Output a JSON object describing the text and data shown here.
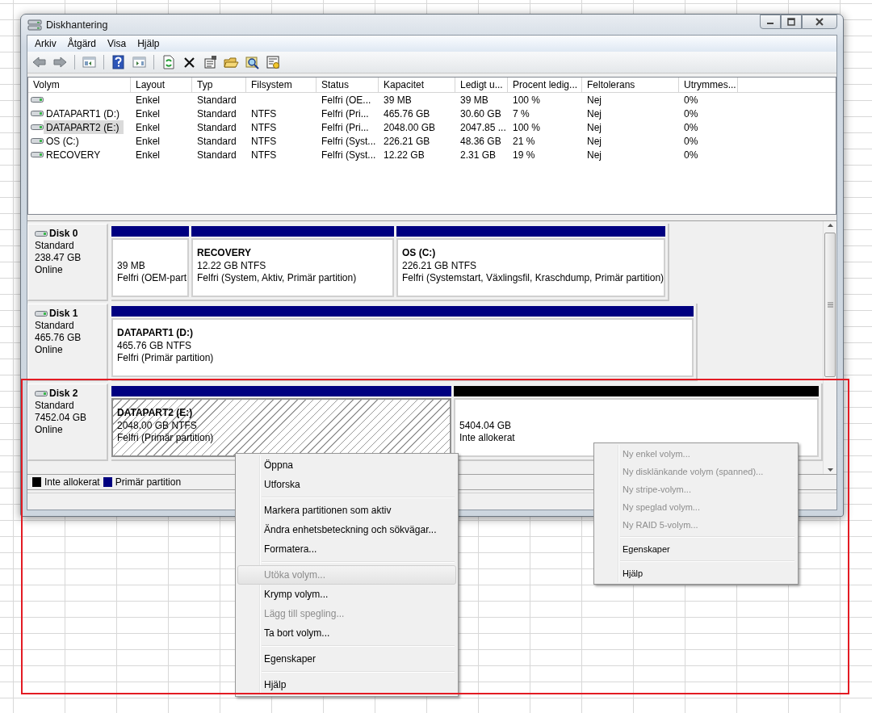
{
  "window": {
    "title": "Diskhantering"
  },
  "menu_bar": [
    "Arkiv",
    "Åtgärd",
    "Visa",
    "Hjälp"
  ],
  "volume_table": {
    "columns": [
      "Volym",
      "Layout",
      "Typ",
      "Filsystem",
      "Status",
      "Kapacitet",
      "Ledigt u...",
      "Procent ledig...",
      "Feltolerans",
      "Utrymmes..."
    ],
    "rows": [
      {
        "selected": false,
        "cells": [
          "",
          "Enkel",
          "Standard",
          "",
          "Felfri (OE...",
          "39 MB",
          "39 MB",
          "100 %",
          "Nej",
          "0%"
        ]
      },
      {
        "selected": false,
        "cells": [
          "DATAPART1 (D:)",
          "Enkel",
          "Standard",
          "NTFS",
          "Felfri (Pri...",
          "465.76 GB",
          "30.60 GB",
          "7 %",
          "Nej",
          "0%"
        ]
      },
      {
        "selected": true,
        "cells": [
          "DATAPART2 (E:)",
          "Enkel",
          "Standard",
          "NTFS",
          "Felfri (Pri...",
          "2048.00 GB",
          "2047.85 ...",
          "100 %",
          "Nej",
          "0%"
        ]
      },
      {
        "selected": false,
        "cells": [
          "OS (C:)",
          "Enkel",
          "Standard",
          "NTFS",
          "Felfri (Syst...",
          "226.21 GB",
          "48.36 GB",
          "21 %",
          "Nej",
          "0%"
        ]
      },
      {
        "selected": false,
        "cells": [
          "RECOVERY",
          "Enkel",
          "Standard",
          "NTFS",
          "Felfri (Syst...",
          "12.22 GB",
          "2.31 GB",
          "19 %",
          "Nej",
          "0%"
        ]
      }
    ]
  },
  "disks": [
    {
      "name": "Disk 0",
      "type": "Standard",
      "size": "238.47 GB",
      "status": "Online",
      "partitions": [
        {
          "kind": "primary",
          "selected": false,
          "size": "39 MB",
          "status": "Felfri (OEM-part"
        },
        {
          "kind": "primary",
          "selected": false,
          "name": "RECOVERY",
          "size": "12.22 GB NTFS",
          "status": "Felfri (System, Aktiv, Primär partition)"
        },
        {
          "kind": "primary",
          "selected": false,
          "name": "OS  (C:)",
          "size": "226.21 GB NTFS",
          "status": "Felfri (Systemstart, Växlingsfil, Kraschdump, Primär partition)"
        }
      ]
    },
    {
      "name": "Disk 1",
      "type": "Standard",
      "size": "465.76 GB",
      "status": "Online",
      "partitions": [
        {
          "kind": "primary",
          "selected": false,
          "name": "DATAPART1  (D:)",
          "size": "465.76 GB NTFS",
          "status": "Felfri (Primär partition)"
        }
      ]
    },
    {
      "name": "Disk 2",
      "type": "Standard",
      "size": "7452.04 GB",
      "status": "Online",
      "partitions": [
        {
          "kind": "primary",
          "selected": true,
          "name": "DATAPART2  (E:)",
          "size": "2048.00 GB NTFS",
          "status": "Felfri (Primär partition)"
        },
        {
          "kind": "unallocated",
          "selected": false,
          "size": "5404.04 GB",
          "status": "Inte allokerat"
        }
      ]
    }
  ],
  "legend": [
    {
      "label": "Inte allokerat",
      "color": "#000000"
    },
    {
      "label": "Primär partition",
      "color": "#000080"
    }
  ],
  "context_menus": [
    {
      "items": [
        {
          "kind": "item",
          "label": "Öppna",
          "disabled": false,
          "highlighted": false
        },
        {
          "kind": "item",
          "label": "Utforska",
          "disabled": false,
          "highlighted": false
        },
        {
          "kind": "separator"
        },
        {
          "kind": "item",
          "label": "Markera partitionen som aktiv",
          "disabled": false,
          "highlighted": false
        },
        {
          "kind": "item",
          "label": "Ändra enhetsbeteckning och sökvägar...",
          "disabled": false,
          "highlighted": false
        },
        {
          "kind": "item",
          "label": "Formatera...",
          "disabled": false,
          "highlighted": false
        },
        {
          "kind": "separator"
        },
        {
          "kind": "item",
          "label": "Utöka volym...",
          "disabled": true,
          "highlighted": true
        },
        {
          "kind": "item",
          "label": "Krymp volym...",
          "disabled": false,
          "highlighted": false
        },
        {
          "kind": "item",
          "label": "Lägg till spegling...",
          "disabled": true,
          "highlighted": false
        },
        {
          "kind": "item",
          "label": "Ta bort volym...",
          "disabled": false,
          "highlighted": false
        },
        {
          "kind": "separator"
        },
        {
          "kind": "item",
          "label": "Egenskaper",
          "disabled": false,
          "highlighted": false
        },
        {
          "kind": "separator"
        },
        {
          "kind": "item",
          "label": "Hjälp",
          "disabled": false,
          "highlighted": false
        }
      ]
    },
    {
      "items": [
        {
          "kind": "item",
          "label": "Ny enkel volym...",
          "disabled": true,
          "highlighted": false
        },
        {
          "kind": "item",
          "label": "Ny disklänkande volym (spanned)...",
          "disabled": true,
          "highlighted": false
        },
        {
          "kind": "item",
          "label": "Ny stripe-volym...",
          "disabled": true,
          "highlighted": false
        },
        {
          "kind": "item",
          "label": "Ny speglad volym...",
          "disabled": true,
          "highlighted": false
        },
        {
          "kind": "item",
          "label": "Ny RAID 5-volym...",
          "disabled": true,
          "highlighted": false
        },
        {
          "kind": "separator"
        },
        {
          "kind": "item",
          "label": "Egenskaper",
          "disabled": false,
          "highlighted": false
        },
        {
          "kind": "separator"
        },
        {
          "kind": "item",
          "label": "Hjälp",
          "disabled": false,
          "highlighted": false
        }
      ]
    }
  ]
}
